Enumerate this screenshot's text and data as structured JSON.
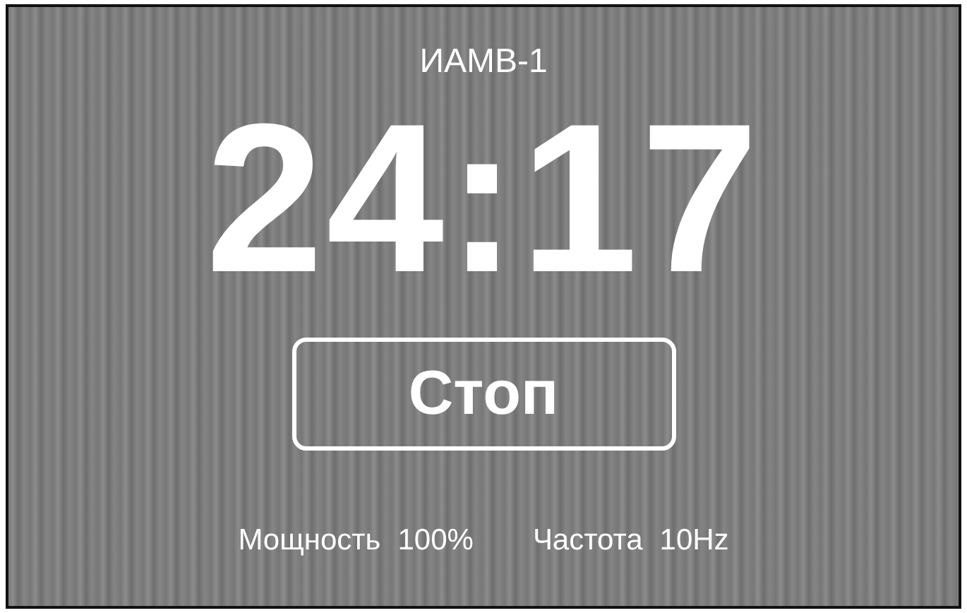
{
  "device": {
    "title": "ИАМВ-1"
  },
  "timer": "24:17",
  "button": {
    "label": "Стоп"
  },
  "stats": [
    {
      "label": "Мощность",
      "value": "100%"
    },
    {
      "label": "Частота",
      "value": "10Hz"
    }
  ]
}
